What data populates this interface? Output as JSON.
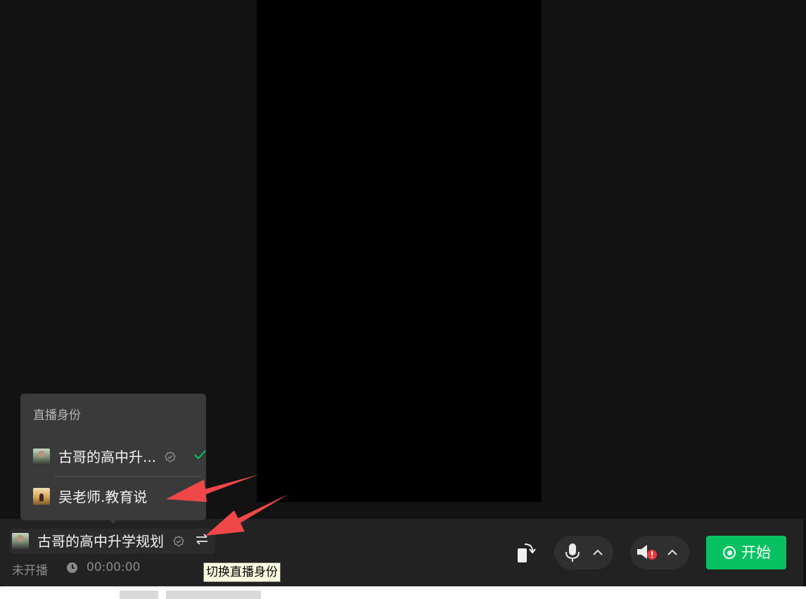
{
  "popover": {
    "title": "直播身份",
    "items": [
      {
        "name": "古哥的高中升...",
        "selected": true
      },
      {
        "name": "吴老师.教育说",
        "selected": false
      }
    ]
  },
  "current_identity": {
    "name": "古哥的高中升学规划",
    "switch_icon": "swap-arrows-icon"
  },
  "status": {
    "label": "未开播",
    "timer": "00:00:00"
  },
  "tooltip": "切换直播身份",
  "controls": {
    "start_label": "开始"
  },
  "colors": {
    "accent": "#07c160",
    "annotation_arrow": "#f04848",
    "alert": "#f0383c"
  }
}
